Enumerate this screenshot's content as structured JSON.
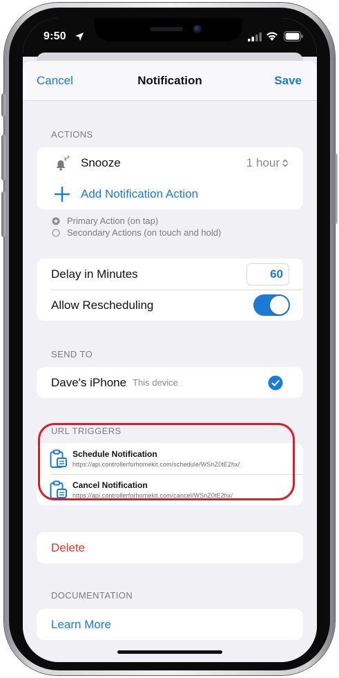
{
  "status_bar": {
    "time": "9:50"
  },
  "nav": {
    "cancel": "Cancel",
    "title": "Notification",
    "save": "Save"
  },
  "actions": {
    "header": "ACTIONS",
    "snooze_label": "Snooze",
    "snooze_value": "1 hour",
    "add_action": "Add Notification Action",
    "primary": "Primary Action (on tap)",
    "secondary": "Secondary Actions (on touch and hold)"
  },
  "settings": {
    "delay_label": "Delay in Minutes",
    "delay_value": "60",
    "rescheduling_label": "Allow Rescheduling",
    "rescheduling_on": true
  },
  "send_to": {
    "header": "SEND TO",
    "device_name": "Dave's iPhone",
    "device_sub": "This device",
    "selected": true
  },
  "url_triggers": {
    "header": "URL TRIGGERS",
    "items": [
      {
        "title": "Schedule Notification",
        "url": "https://api.controllerforhomekit.com/schedule/WSnZ0tE2hx/"
      },
      {
        "title": "Cancel Notification",
        "url": "https://api.controllerforhomekit.com/cancel/WSnZ0tE2hx/"
      }
    ]
  },
  "delete": {
    "label": "Delete"
  },
  "documentation": {
    "header": "DOCUMENTATION",
    "learn_more": "Learn More"
  },
  "colors": {
    "accent": "#1a7bd6",
    "destructive": "#e0362a",
    "highlight_ring": "#d81e2a",
    "background": "#f1f1f5"
  },
  "icons": {
    "snooze": "bell-zzz-icon",
    "add": "plus-icon",
    "primary_radio": "star-circle-icon",
    "secondary_radio": "empty-circle-icon",
    "selected": "checkmark-circle-icon",
    "url_trigger": "clipboard-icon"
  }
}
